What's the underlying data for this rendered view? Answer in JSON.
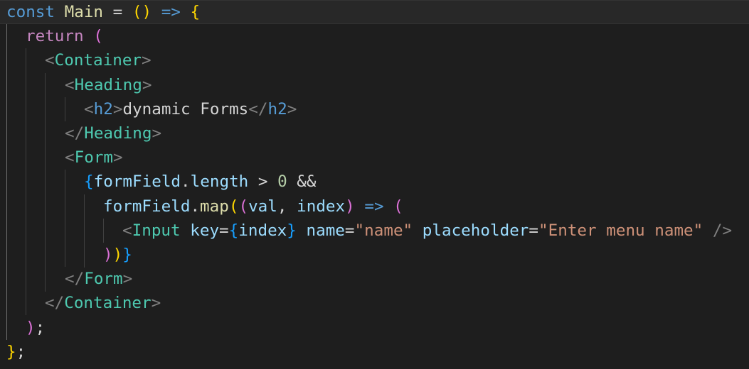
{
  "lines": [
    [
      [
        "const",
        "kw"
      ],
      [
        " ",
        "pun"
      ],
      [
        "Main",
        "fn"
      ],
      [
        " = ",
        "pun"
      ],
      [
        "(",
        "b1"
      ],
      [
        ")",
        "b1"
      ],
      [
        " ",
        "pun"
      ],
      [
        "=>",
        "kw"
      ],
      [
        " ",
        "pun"
      ],
      [
        "{",
        "b1"
      ]
    ],
    [
      [
        "return",
        "kw2"
      ],
      [
        " ",
        "pun"
      ],
      [
        "(",
        "b2"
      ]
    ],
    [
      [
        "<",
        "ang"
      ],
      [
        "Container",
        "tag"
      ],
      [
        ">",
        "ang"
      ]
    ],
    [
      [
        "<",
        "ang"
      ],
      [
        "Heading",
        "tag"
      ],
      [
        ">",
        "ang"
      ]
    ],
    [
      [
        "<",
        "ang"
      ],
      [
        "h2",
        "htag"
      ],
      [
        ">",
        "ang"
      ],
      [
        "dynamic Forms",
        "pun"
      ],
      [
        "</",
        "ang"
      ],
      [
        "h2",
        "htag"
      ],
      [
        ">",
        "ang"
      ]
    ],
    [
      [
        "</",
        "ang"
      ],
      [
        "Heading",
        "tag"
      ],
      [
        ">",
        "ang"
      ]
    ],
    [
      [
        "<",
        "ang"
      ],
      [
        "Form",
        "tag"
      ],
      [
        ">",
        "ang"
      ]
    ],
    [
      [
        "{",
        "b3"
      ],
      [
        "formField",
        "var"
      ],
      [
        ".",
        "pun"
      ],
      [
        "length",
        "var"
      ],
      [
        " > ",
        "pun"
      ],
      [
        "0",
        "num"
      ],
      [
        " &&",
        "pun"
      ]
    ],
    [
      [
        "formField",
        "var"
      ],
      [
        ".",
        "pun"
      ],
      [
        "map",
        "fn"
      ],
      [
        "(",
        "b1"
      ],
      [
        "(",
        "b2"
      ],
      [
        "val",
        "var"
      ],
      [
        ", ",
        "pun"
      ],
      [
        "index",
        "var"
      ],
      [
        ")",
        "b2"
      ],
      [
        " ",
        "pun"
      ],
      [
        "=>",
        "kw"
      ],
      [
        " ",
        "pun"
      ],
      [
        "(",
        "b2"
      ]
    ],
    [
      [
        "<",
        "ang"
      ],
      [
        "Input",
        "tag"
      ],
      [
        " ",
        "pun"
      ],
      [
        "key",
        "attr"
      ],
      [
        "=",
        "pun"
      ],
      [
        "{",
        "b3"
      ],
      [
        "index",
        "var"
      ],
      [
        "}",
        "b3"
      ],
      [
        " ",
        "pun"
      ],
      [
        "name",
        "attr"
      ],
      [
        "=",
        "pun"
      ],
      [
        "\"name\"",
        "str"
      ],
      [
        " ",
        "pun"
      ],
      [
        "placeholder",
        "attr"
      ],
      [
        "=",
        "pun"
      ],
      [
        "\"Enter menu name\"",
        "str"
      ],
      [
        " ",
        "pun"
      ],
      [
        "/>",
        "ang"
      ]
    ],
    [
      [
        ")",
        "b2"
      ],
      [
        ")",
        "b1"
      ],
      [
        "}",
        "b3"
      ]
    ],
    [
      [
        "</",
        "ang"
      ],
      [
        "Form",
        "tag"
      ],
      [
        ">",
        "ang"
      ]
    ],
    [
      [
        "</",
        "ang"
      ],
      [
        "Container",
        "tag"
      ],
      [
        ">",
        "ang"
      ]
    ],
    [
      [
        ")",
        "b2"
      ],
      [
        ";",
        "pun"
      ]
    ],
    [
      [
        "}",
        "b1"
      ],
      [
        ";",
        "pun"
      ]
    ]
  ]
}
